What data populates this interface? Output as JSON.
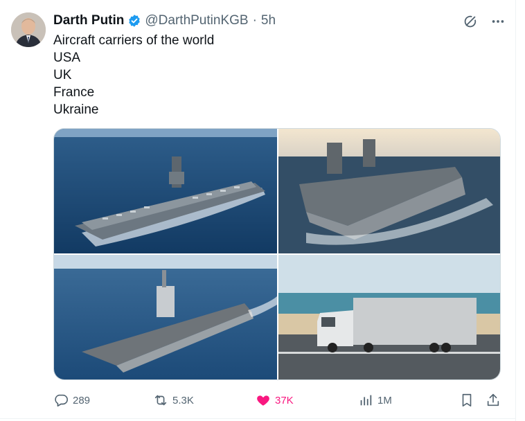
{
  "tweet": {
    "display_name": "Darth Putin",
    "handle": "@DarthPutinKGB",
    "separator": "·",
    "time": "5h",
    "lines": [
      "Aircraft carriers of the world",
      "USA",
      "UK",
      "France",
      "Ukraine"
    ]
  },
  "media": [
    {
      "subject": "aircraft carrier (USA)"
    },
    {
      "subject": "aircraft carrier (UK)"
    },
    {
      "subject": "aircraft carrier (France)"
    },
    {
      "subject": "white truck on road (Ukraine)"
    }
  ],
  "actions": {
    "replies": "289",
    "reposts": "5.3K",
    "likes": "37K",
    "views": "1M"
  },
  "colors": {
    "accent": "#1d9bf0",
    "like": "#f91880",
    "muted": "#536471"
  },
  "icons": [
    "verified-badge-icon",
    "grok-icon",
    "more-icon",
    "reply-icon",
    "repost-icon",
    "like-icon",
    "views-icon",
    "bookmark-icon",
    "share-icon"
  ]
}
